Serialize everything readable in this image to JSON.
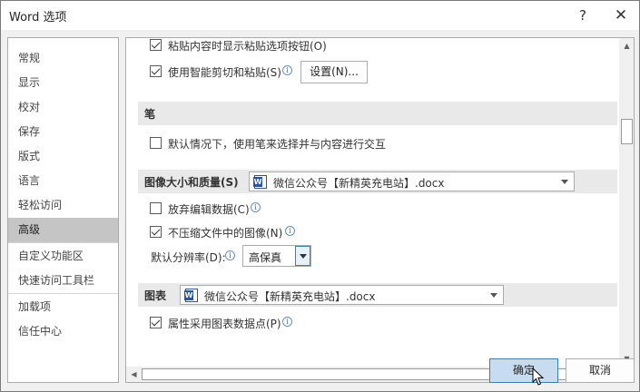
{
  "window": {
    "title": "Word 选项",
    "help_glyph": "?",
    "close_glyph": "✕"
  },
  "sidebar": {
    "items": [
      {
        "label": "常规"
      },
      {
        "label": "显示"
      },
      {
        "label": "校对"
      },
      {
        "label": "保存"
      },
      {
        "label": "版式"
      },
      {
        "label": "语言"
      },
      {
        "label": "轻松访问"
      },
      {
        "label": "高级",
        "active": true
      },
      {
        "label": "自定义功能区"
      },
      {
        "label": "快速访问工具栏"
      },
      {
        "label": "加载项"
      },
      {
        "label": "信任中心"
      }
    ]
  },
  "content": {
    "paste_button_label": "粘贴内容时显示粘贴选项按钮(O)",
    "paste_button_checked": true,
    "smart_cut_label": "使用智能剪切和粘贴(S)",
    "smart_cut_checked": true,
    "settings_button": "设置(N)...",
    "pen_section": "笔",
    "pen_option_label": "默认情况下，使用笔来选择并与内容进行交互",
    "pen_option_checked": false,
    "image_section": "图像大小和质量(S)",
    "image_document": "微信公众号【新精英充电站】.docx",
    "discard_edit_label": "放弃编辑数据(C)",
    "discard_edit_checked": false,
    "no_compress_label": "不压缩文件中的图像(N)",
    "no_compress_checked": true,
    "default_resolution_label": "默认分辨率(D):",
    "default_resolution_value": "高保真",
    "chart_section": "图表",
    "chart_document": "微信公众号【新精英充电站】.docx",
    "chart_props_label": "属性采用图表数据点(P)",
    "chart_props_checked": true
  },
  "footer": {
    "ok": "确定",
    "cancel": "取消"
  },
  "icons": {
    "info": "i",
    "up": "▲",
    "down": "▼",
    "left": "◀",
    "right": "▶"
  }
}
